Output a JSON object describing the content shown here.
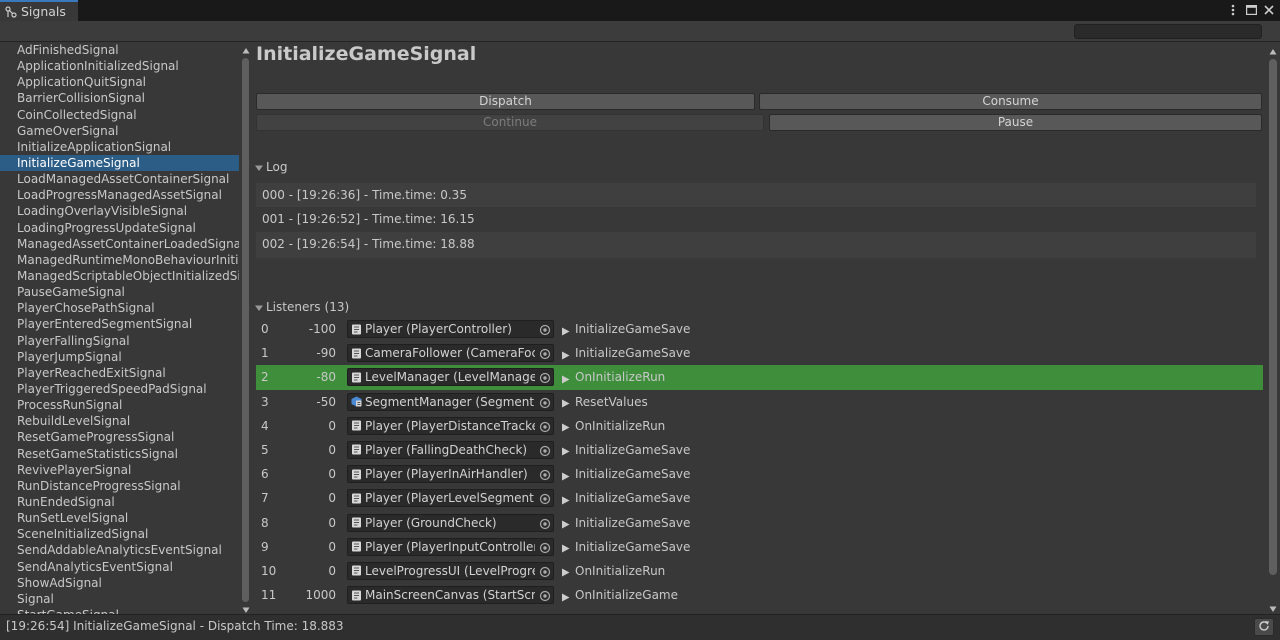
{
  "window": {
    "tab_title": "Signals"
  },
  "search": {
    "value": "",
    "placeholder": ""
  },
  "sidebar": {
    "selected_index": 7,
    "items": [
      "AdFinishedSignal",
      "ApplicationInitializedSignal",
      "ApplicationQuitSignal",
      "BarrierCollisionSignal",
      "CoinCollectedSignal",
      "GameOverSignal",
      "InitializeApplicationSignal",
      "InitializeGameSignal",
      "LoadManagedAssetContainerSignal",
      "LoadProgressManagedAssetSignal",
      "LoadingOverlayVisibleSignal",
      "LoadingProgressUpdateSignal",
      "ManagedAssetContainerLoadedSignal",
      "ManagedRuntimeMonoBehaviourInitializ",
      "ManagedScriptableObjectInitializedSign",
      "PauseGameSignal",
      "PlayerChosePathSignal",
      "PlayerEnteredSegmentSignal",
      "PlayerFallingSignal",
      "PlayerJumpSignal",
      "PlayerReachedExitSignal",
      "PlayerTriggeredSpeedPadSignal",
      "ProcessRunSignal",
      "RebuildLevelSignal",
      "ResetGameProgressSignal",
      "ResetGameStatisticsSignal",
      "RevivePlayerSignal",
      "RunDistanceProgressSignal",
      "RunEndedSignal",
      "RunSetLevelSignal",
      "SceneInitializedSignal",
      "SendAddableAnalyticsEventSignal",
      "SendAnalyticsEventSignal",
      "ShowAdSignal",
      "Signal",
      "StartGameSignal"
    ]
  },
  "main": {
    "title": "InitializeGameSignal",
    "buttons": {
      "dispatch": "Dispatch",
      "consume": "Consume",
      "continue": "Continue",
      "pause": "Pause"
    },
    "log": {
      "label": "Log",
      "entries": [
        "000 - [19:26:36] - Time.time: 0.35",
        "001 - [19:26:52] - Time.time: 16.15",
        "002 - [19:26:54] - Time.time: 18.88"
      ]
    },
    "listeners": {
      "label": "Listeners",
      "count": "(13)",
      "highlight_index": 2,
      "rows": [
        {
          "index": "0",
          "order": "-100",
          "object": "Player (PlayerController)",
          "icon": "script-icon",
          "method": "InitializeGameSave"
        },
        {
          "index": "1",
          "order": "-90",
          "object": "CameraFollower (CameraFocu",
          "icon": "script-icon",
          "method": "InitializeGameSave"
        },
        {
          "index": "2",
          "order": "-80",
          "object": "LevelManager (LevelManager)",
          "icon": "script-icon",
          "method": "OnInitializeRun"
        },
        {
          "index": "3",
          "order": "-50",
          "object": "SegmentManager (SegmentMa",
          "icon": "prefab-script-icon",
          "method": "ResetValues"
        },
        {
          "index": "4",
          "order": "0",
          "object": "Player (PlayerDistanceTracker",
          "icon": "script-icon",
          "method": "OnInitializeRun"
        },
        {
          "index": "5",
          "order": "0",
          "object": "Player (FallingDeathCheck)",
          "icon": "script-icon",
          "method": "InitializeGameSave"
        },
        {
          "index": "6",
          "order": "0",
          "object": "Player (PlayerInAirHandler)",
          "icon": "script-icon",
          "method": "InitializeGameSave"
        },
        {
          "index": "7",
          "order": "0",
          "object": "Player (PlayerLevelSegmentLis",
          "icon": "script-icon",
          "method": "InitializeGameSave"
        },
        {
          "index": "8",
          "order": "0",
          "object": "Player (GroundCheck)",
          "icon": "script-icon",
          "method": "InitializeGameSave"
        },
        {
          "index": "9",
          "order": "0",
          "object": "Player (PlayerInputController)",
          "icon": "script-icon",
          "method": "InitializeGameSave"
        },
        {
          "index": "10",
          "order": "0",
          "object": "LevelProgressUI (LevelProgres",
          "icon": "script-icon",
          "method": "OnInitializeRun"
        },
        {
          "index": "11",
          "order": "1000",
          "object": "MainScreenCanvas (StartScre",
          "icon": "script-icon",
          "method": "OnInitializeGame"
        }
      ]
    }
  },
  "status": {
    "text": "[19:26:54] InitializeGameSignal - Dispatch Time: 18.883"
  },
  "colors": {
    "selection": "#2c5d87",
    "highlight_row": "#3e8e3c",
    "tab_accent": "#3a79bb"
  }
}
